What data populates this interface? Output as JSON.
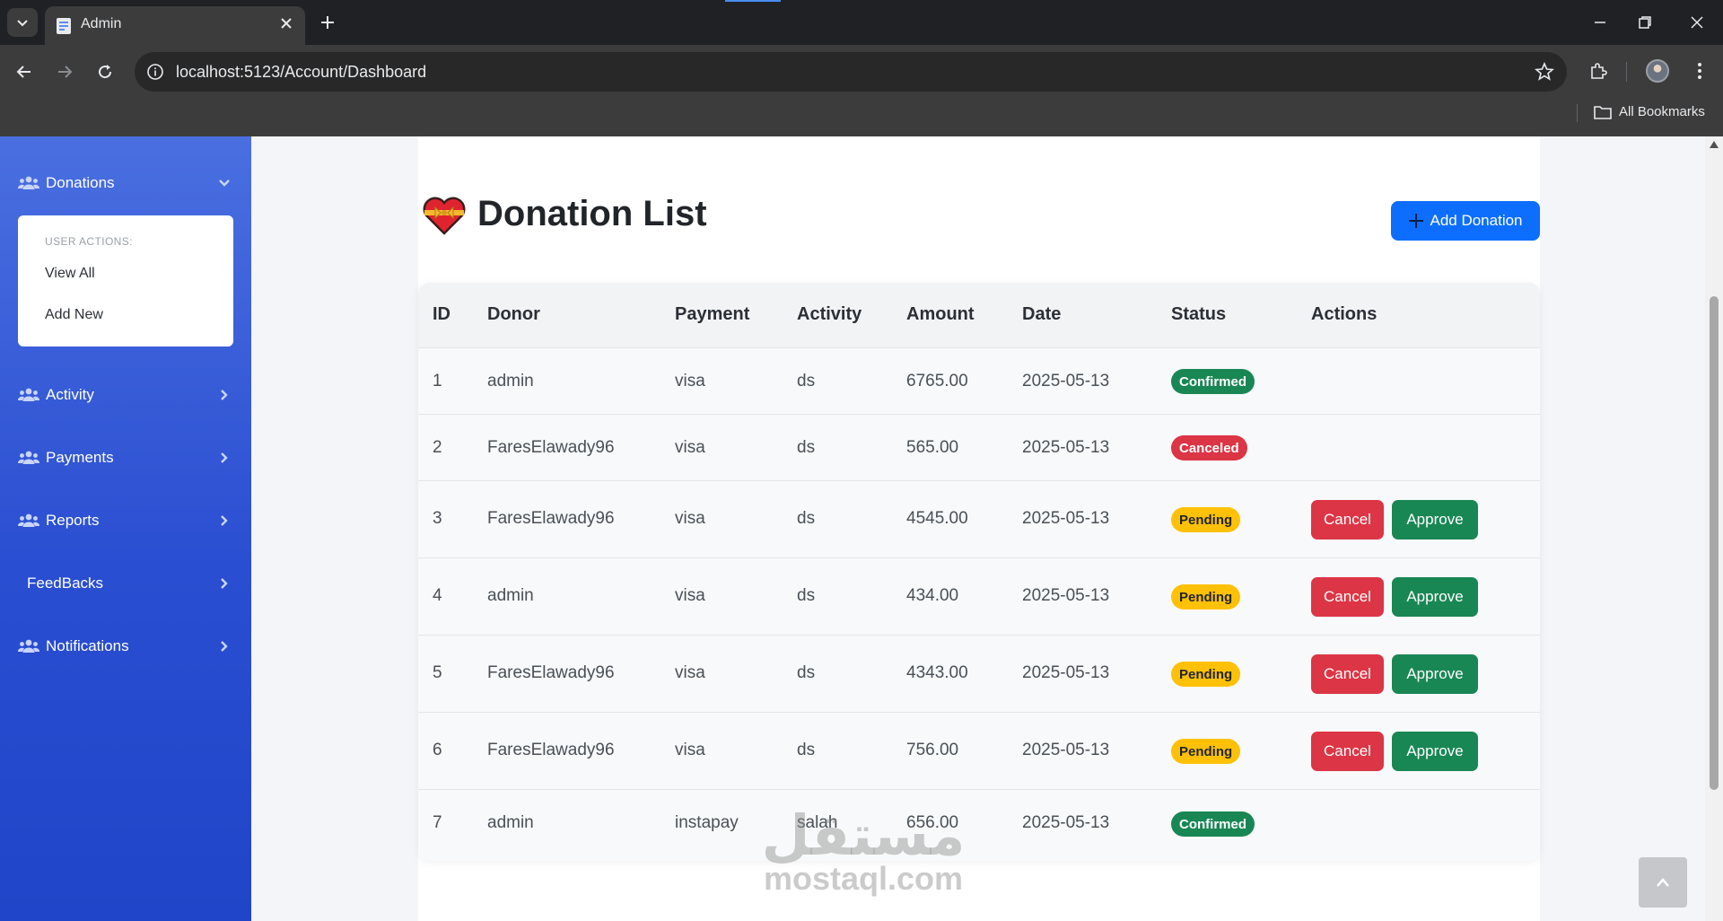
{
  "browser": {
    "tab_title": "Admin",
    "url": "localhost:5123/Account/Dashboard",
    "bookmarks_label": "All Bookmarks",
    "icons": [
      "tab-search-icon",
      "favicon-icon",
      "close-icon",
      "plus-icon",
      "minimize-icon",
      "restore-icon",
      "close-window-icon",
      "back-icon",
      "forward-icon",
      "reload-icon",
      "info-icon",
      "star-icon",
      "extensions-icon",
      "menu-icon",
      "folder-icon"
    ]
  },
  "sidebar": {
    "items": [
      {
        "label": "Donations",
        "icon": "users-icon",
        "chevron": "down"
      },
      {
        "label": "Activity",
        "icon": "users-icon",
        "chevron": "right"
      },
      {
        "label": "Payments",
        "icon": "users-icon",
        "chevron": "right"
      },
      {
        "label": "Reports",
        "icon": "users-icon",
        "chevron": "right"
      },
      {
        "label": "FeedBacks",
        "icon": null,
        "chevron": "right"
      },
      {
        "label": "Notifications",
        "icon": "users-icon",
        "chevron": "right"
      }
    ],
    "submenu": {
      "header": "USER ACTIONS:",
      "items": [
        "View All",
        "Add New"
      ]
    }
  },
  "main": {
    "title": "Donation List",
    "title_icon": "heart-ribbon-icon",
    "add_button": "Add Donation",
    "columns": [
      "ID",
      "Donor",
      "Payment",
      "Activity",
      "Amount",
      "Date",
      "Status",
      "Actions"
    ],
    "rows": [
      {
        "id": "1",
        "donor": "admin",
        "payment": "visa",
        "activity": "ds",
        "amount": "6765.00",
        "date": "2025-05-13",
        "status": "Confirmed"
      },
      {
        "id": "2",
        "donor": "FaresElawady96",
        "payment": "visa",
        "activity": "ds",
        "amount": "565.00",
        "date": "2025-05-13",
        "status": "Canceled"
      },
      {
        "id": "3",
        "donor": "FaresElawady96",
        "payment": "visa",
        "activity": "ds",
        "amount": "4545.00",
        "date": "2025-05-13",
        "status": "Pending"
      },
      {
        "id": "4",
        "donor": "admin",
        "payment": "visa",
        "activity": "ds",
        "amount": "434.00",
        "date": "2025-05-13",
        "status": "Pending"
      },
      {
        "id": "5",
        "donor": "FaresElawady96",
        "payment": "visa",
        "activity": "ds",
        "amount": "4343.00",
        "date": "2025-05-13",
        "status": "Pending"
      },
      {
        "id": "6",
        "donor": "FaresElawady96",
        "payment": "visa",
        "activity": "ds",
        "amount": "756.00",
        "date": "2025-05-13",
        "status": "Pending"
      },
      {
        "id": "7",
        "donor": "admin",
        "payment": "instapay",
        "activity": "salah",
        "amount": "656.00",
        "date": "2025-05-13",
        "status": "Confirmed"
      }
    ],
    "actions": {
      "cancel": "Cancel",
      "approve": "Approve"
    }
  },
  "watermark": {
    "arabic": "مستقل",
    "latin": "mostaql.com"
  },
  "colors": {
    "primary": "#0d6efd",
    "success": "#198754",
    "danger": "#dc3545",
    "warning": "#ffc107",
    "sidebar_top": "#4a6fe0",
    "sidebar_bottom": "#2045c8"
  }
}
